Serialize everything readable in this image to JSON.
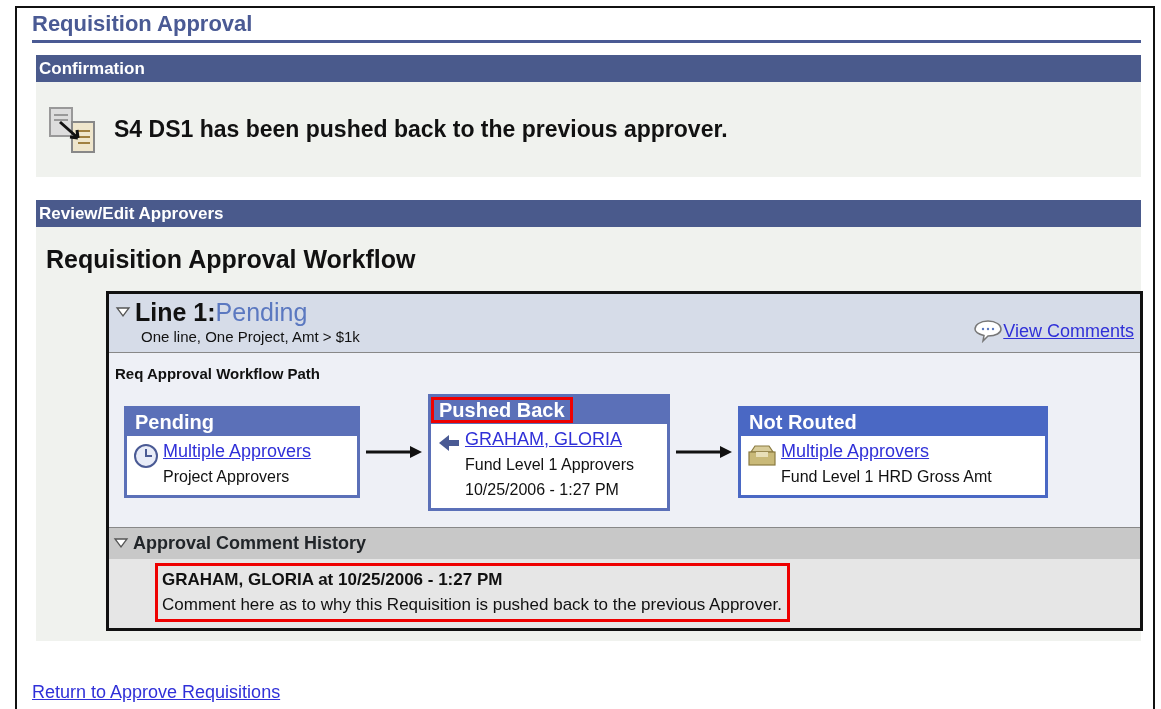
{
  "page_title": "Requisition Approval",
  "confirmation": {
    "header": "Confirmation",
    "message": "S4 DS1 has been pushed back to the previous approver."
  },
  "review": {
    "header": "Review/Edit Approvers",
    "workflow_title": "Requisition Approval Workflow",
    "line": {
      "label": "Line 1:",
      "status": "Pending",
      "expanded": true,
      "description": "One line, One Project, Amt > $1k",
      "view_comments": "View Comments",
      "path_title": "Req Approval Workflow Path",
      "steps": [
        {
          "status": "Pending",
          "kind": "clock",
          "highlighted": false,
          "approver": "Multiple Approvers",
          "role": "Project Approvers",
          "color": "#5b70b8"
        },
        {
          "status": "Pushed Back",
          "kind": "pushback",
          "highlighted": true,
          "approver": "GRAHAM, GLORIA",
          "role": "Fund Level 1 Approvers",
          "date": "10/25/2006 - 1:27 PM",
          "color": "#5b70b8"
        },
        {
          "status": "Not Routed",
          "kind": "tray",
          "highlighted": false,
          "approver": "Multiple Approvers",
          "role": "Fund Level 1 HRD Gross Amt",
          "color": "#4a68c4"
        }
      ],
      "history": {
        "header": "Approval Comment History",
        "expanded": true,
        "comments": [
          {
            "author": "GRAHAM, GLORIA at 10/25/2006 - 1:27 PM",
            "text": "Comment here as to why this Requisition is pushed back to the previous Approver.",
            "highlighted": true
          }
        ]
      }
    }
  },
  "return_link": "Return to Approve Requisitions"
}
